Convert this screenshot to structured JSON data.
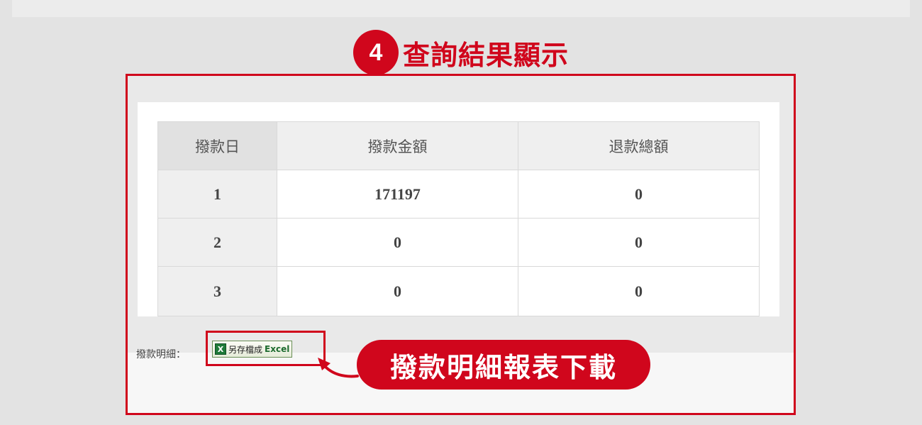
{
  "step": {
    "number": "4",
    "title": "查詢結果顯示"
  },
  "table": {
    "headers": [
      "撥款日",
      "撥款金額",
      "退款總額"
    ],
    "rows": [
      [
        "1",
        "171197",
        "0"
      ],
      [
        "2",
        "0",
        "0"
      ],
      [
        "3",
        "0",
        "0"
      ]
    ]
  },
  "detail": {
    "label": "撥款明細：",
    "excel_icon_text": "X",
    "excel_button_text": "另存檔成",
    "excel_button_word": "Excel"
  },
  "callout": {
    "text": "撥款明細報表下載"
  },
  "colors": {
    "accent": "#d0061c"
  }
}
